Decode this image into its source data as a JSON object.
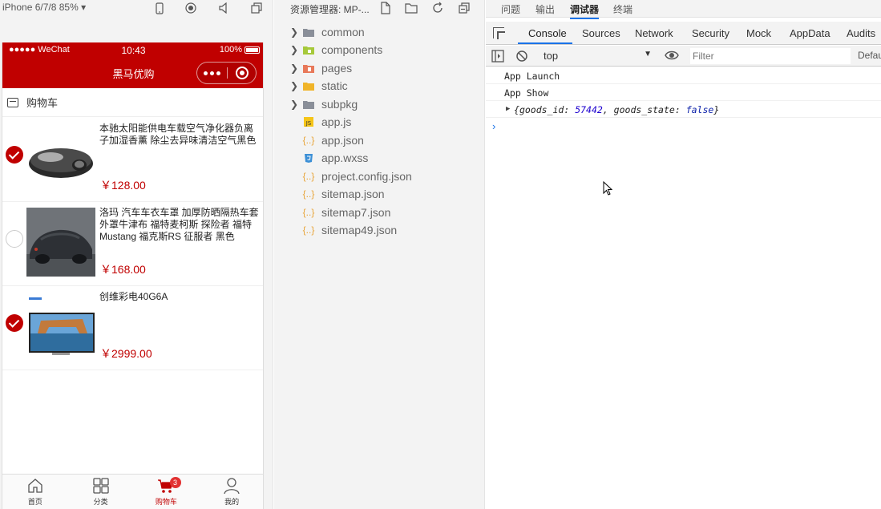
{
  "simulator": {
    "device_label": "iPhone 6/7/8 85%",
    "status_bar": {
      "signal": "●●●●● WeChat",
      "time": "10:43",
      "battery": "100%"
    },
    "nav_title": "黑马优购",
    "cart_header": "购物车",
    "goods": [
      {
        "name": "本驰太阳能供电车载空气净化器负离子加湿香薰 除尘去异味清洁空气黑色",
        "price": "￥128.00",
        "checked": true
      },
      {
        "name": "洛玛 汽车车衣车罩 加厚防晒隔热车套外罩牛津布 福特麦柯斯 探险者 福特Mustang 福克斯RS 征服者 黑色",
        "price": "￥168.00",
        "checked": false
      },
      {
        "name": "创维彩电40G6A",
        "price": "￥2999.00",
        "checked": true
      }
    ],
    "tabbar": {
      "items": [
        "首页",
        "分类",
        "购物车",
        "我的"
      ],
      "badge": "3"
    }
  },
  "explorer": {
    "title": "资源管理器: MP-...",
    "folders": [
      "common",
      "components",
      "pages",
      "static",
      "subpkg"
    ],
    "files": [
      "app.js",
      "app.json",
      "app.wxss",
      "project.config.json",
      "sitemap.json",
      "sitemap7.json",
      "sitemap49.json"
    ]
  },
  "devtools": {
    "top_tabs": [
      "问题",
      "输出",
      "调试器",
      "终端"
    ],
    "panel_tabs": [
      "Console",
      "Sources",
      "Network",
      "Security",
      "Mock",
      "AppData",
      "Audits"
    ],
    "context": "top",
    "filter_placeholder": "Filter",
    "levels": "Default levels",
    "logs": [
      "App Launch",
      "App Show"
    ],
    "object_log": {
      "open": "{",
      "k1": "goods_id",
      "v1": "57442",
      "k2": "goods_state",
      "v2": "false",
      "close": "}"
    }
  },
  "colors": {
    "brand": "#c00000",
    "devtools_accent": "#1a73e8"
  }
}
